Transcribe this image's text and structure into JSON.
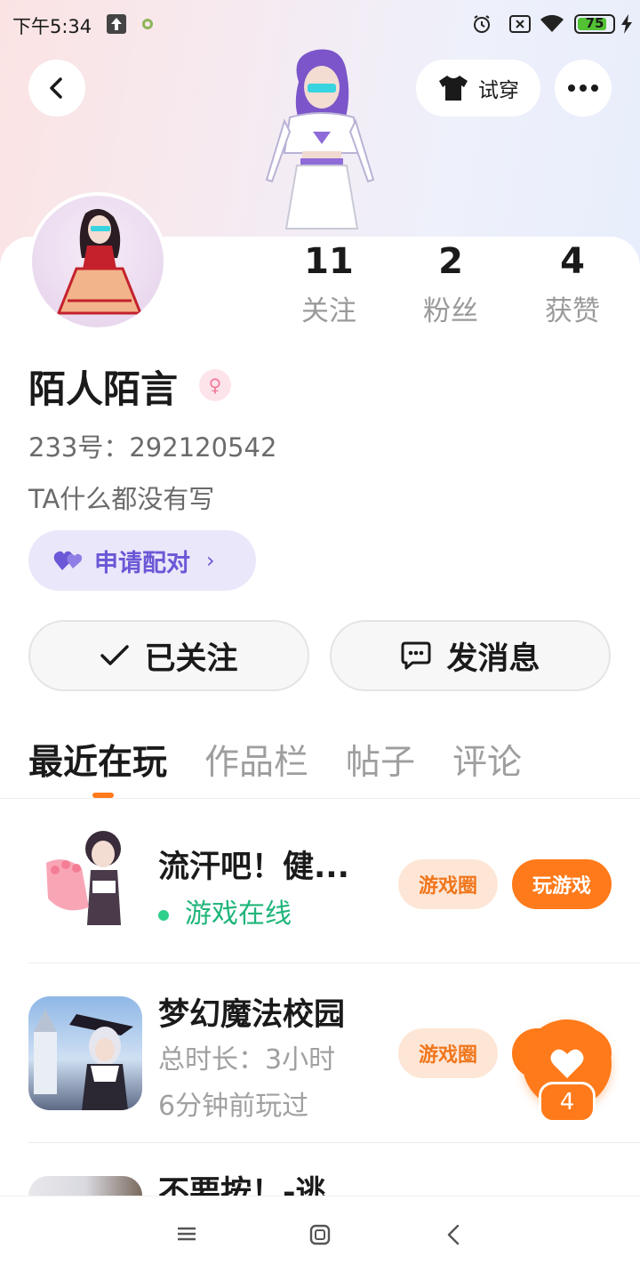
{
  "status_bar": {
    "time": "下午5:34",
    "battery_level": "75"
  },
  "header": {
    "tryon_label": "试穿"
  },
  "profile": {
    "username": "陌人陌言",
    "gender_symbol": "♀",
    "user_id": "233号：292120542",
    "bio": "TA什么都没有写"
  },
  "stats": [
    {
      "value": "11",
      "label": "关注"
    },
    {
      "value": "2",
      "label": "粉丝"
    },
    {
      "value": "4",
      "label": "获赞"
    }
  ],
  "pair": {
    "label": "申请配对"
  },
  "actions": {
    "follow_label": "已关注",
    "message_label": "发消息"
  },
  "tabs": [
    {
      "label": "最近在玩"
    },
    {
      "label": "作品栏"
    },
    {
      "label": "帖子"
    },
    {
      "label": "评论"
    }
  ],
  "games": [
    {
      "title": "流汗吧！健...",
      "status": "游戏在线",
      "circle_label": "游戏圈",
      "play_label": "玩游戏"
    },
    {
      "title": "梦幻魔法校园",
      "duration": "总时长：3小时",
      "last_played": "6分钟前玩过",
      "circle_label": "游戏圈"
    },
    {
      "title": "不要按！-逃"
    }
  ],
  "floating_like": {
    "count": "4"
  },
  "colors": {
    "accent_orange": "#ff7a1a",
    "pair_purple": "#6a58d6",
    "online_green": "#1fb57a"
  }
}
